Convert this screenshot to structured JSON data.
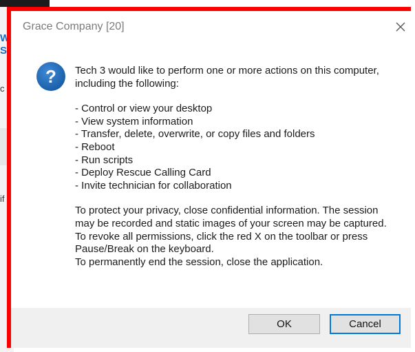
{
  "background": {
    "link_fragments": [
      "W",
      "S"
    ],
    "text_fragments": [
      "c",
      "if"
    ]
  },
  "dialog": {
    "title": "Grace Company [20]",
    "close_glyph": "✕",
    "icon": "question-icon",
    "intro": "Tech 3 would like to perform one or more actions on this computer, including the following:",
    "actions": [
      "- Control or view your desktop",
      "- View system information",
      "- Transfer, delete, overwrite, or copy files and folders",
      "- Reboot",
      "- Run scripts",
      "- Deploy Rescue Calling Card",
      "- Invite technician for collaboration"
    ],
    "notes": [
      "To protect your privacy, close confidential information. The session may be recorded and static images of your screen may be captured.",
      "To revoke all permissions, click the red X on the toolbar or press Pause/Break on the keyboard.",
      "To permanently end the session, close the application."
    ],
    "ok_label": "OK",
    "cancel_label": "Cancel"
  },
  "colors": {
    "highlight": "#ff0000",
    "icon_blue": "#1e6fb8",
    "focus_border": "#0078d7"
  }
}
